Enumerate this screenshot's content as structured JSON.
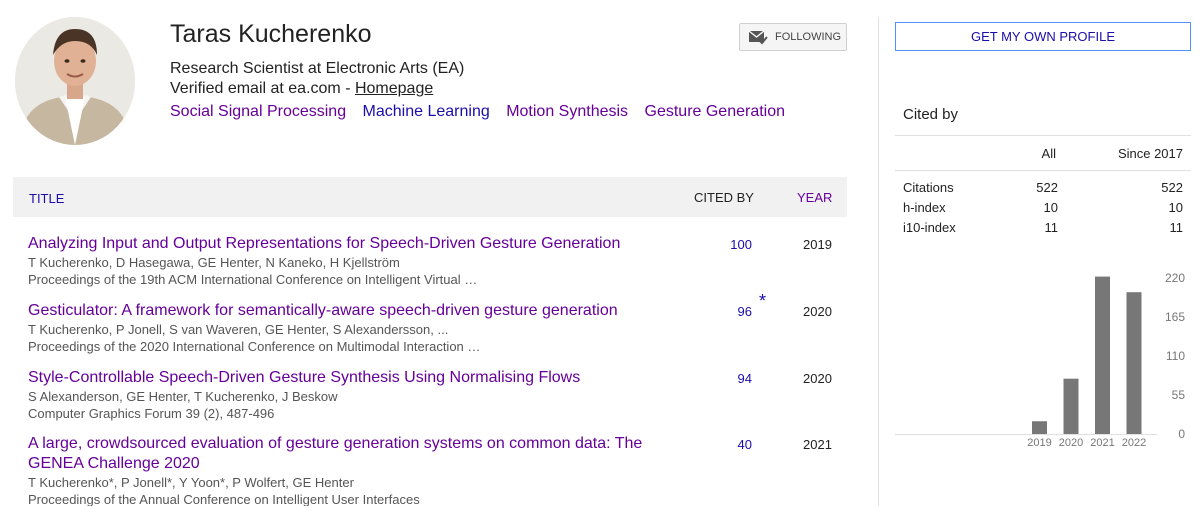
{
  "profile": {
    "name": "Taras Kucherenko",
    "affiliation": "Research Scientist at Electronic Arts (EA)",
    "email_prefix": "Verified email at ea.com - ",
    "homepage_label": "Homepage",
    "interests": [
      "Social Signal Processing",
      "Machine Learning",
      "Motion Synthesis",
      "Gesture Generation"
    ],
    "follow_label": "FOLLOWING"
  },
  "table": {
    "headers": {
      "title": "TITLE",
      "cited_by": "CITED BY",
      "year": "YEAR"
    },
    "articles": [
      {
        "title": "Analyzing Input and Output Representations for Speech-Driven Gesture Generation",
        "authors": "T Kucherenko, D Hasegawa, GE Henter, N Kaneko, H Kjellström",
        "venue": "Proceedings of the 19th ACM International Conference on Intelligent Virtual …",
        "cited_by": "100",
        "year": "2019"
      },
      {
        "title": "Gesticulator: A framework for semantically-aware speech-driven gesture generation",
        "authors": "T Kucherenko, P Jonell, S van Waveren, GE Henter, S Alexandersson, ...",
        "venue": "Proceedings of the 2020 International Conference on Multimodal Interaction …",
        "cited_by": "96",
        "star": "*",
        "year": "2020"
      },
      {
        "title": "Style-Controllable Speech-Driven Gesture Synthesis Using Normalising Flows",
        "authors": "S Alexanderson, GE Henter, T Kucherenko, J Beskow",
        "venue": "Computer Graphics Forum 39 (2), 487-496",
        "cited_by": "94",
        "year": "2020"
      },
      {
        "title": "A large, crowdsourced evaluation of gesture generation systems on common data: The GENEA Challenge 2020",
        "authors": "T Kucherenko*, P Jonell*, Y Yoon*, P Wolfert, GE Henter",
        "venue": "Proceedings of the Annual Conference on Intelligent User Interfaces",
        "cited_by": "40",
        "year": "2021"
      }
    ]
  },
  "sidebar": {
    "own_profile_label": "GET MY OWN PROFILE",
    "cited_by_title": "Cited by",
    "stats_headers": {
      "all": "All",
      "since": "Since 2017"
    },
    "stats": [
      {
        "label": "Citations",
        "all": "522",
        "since": "522"
      },
      {
        "label": "h-index",
        "all": "10",
        "since": "10"
      },
      {
        "label": "i10-index",
        "all": "11",
        "since": "11"
      }
    ]
  },
  "chart_data": {
    "type": "bar",
    "categories": [
      "2019",
      "2020",
      "2021",
      "2022"
    ],
    "values": [
      18,
      78,
      222,
      200
    ],
    "ylim": [
      0,
      220
    ],
    "yticks": [
      "220",
      "165",
      "110",
      "55",
      "0"
    ],
    "bar_color": "#777777"
  }
}
